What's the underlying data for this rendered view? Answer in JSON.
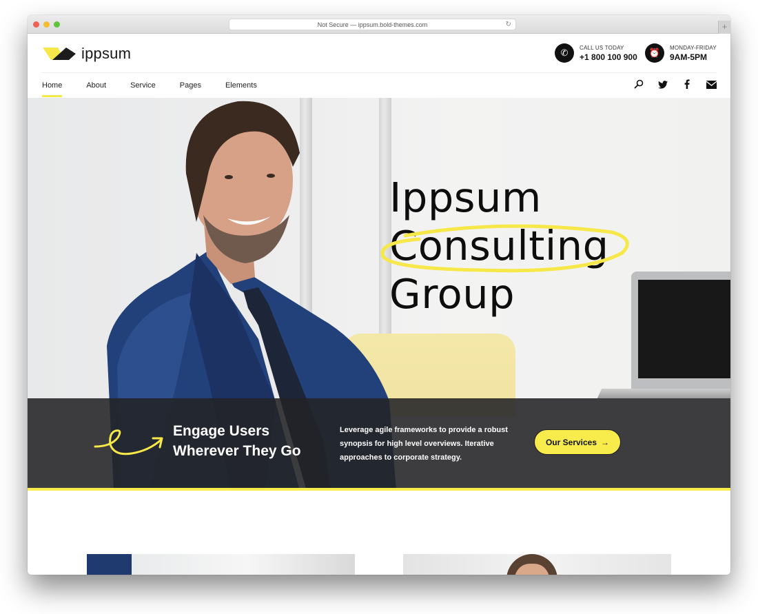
{
  "browser": {
    "url_text": "Not Secure — ippsum.bold-themes.com",
    "reload_icon": "reload-icon",
    "new_tab_label": "+"
  },
  "header": {
    "logo_text": "ippsum",
    "contacts": [
      {
        "icon": "phone-icon",
        "label": "CALL US TODAY",
        "value": "+1 800 100 900"
      },
      {
        "icon": "alarm-clock-icon",
        "label": "MONDAY-FRIDAY",
        "value": "9AM-5PM"
      }
    ],
    "nav": [
      {
        "label": "Home",
        "active": true
      },
      {
        "label": "About",
        "active": false
      },
      {
        "label": "Service",
        "active": false
      },
      {
        "label": "Pages",
        "active": false
      },
      {
        "label": "Elements",
        "active": false
      }
    ],
    "nav_icons": [
      "search-icon",
      "twitter-icon",
      "facebook-icon",
      "mail-icon"
    ]
  },
  "hero": {
    "title_lines": [
      "Ippsum",
      "Consulting",
      "Group"
    ],
    "highlighted_word": "Consulting"
  },
  "band": {
    "heading_lines": [
      "Engage Users",
      "Wherever They Go"
    ],
    "text": "Leverage agile frameworks to provide a robust synopsis for high level overviews. Iterative approaches to corporate strategy.",
    "button_label": "Our Services",
    "button_arrow": "→"
  },
  "colors": {
    "accent_yellow": "#f8ec4c",
    "dark": "#111111",
    "band_bg": "#232326"
  }
}
